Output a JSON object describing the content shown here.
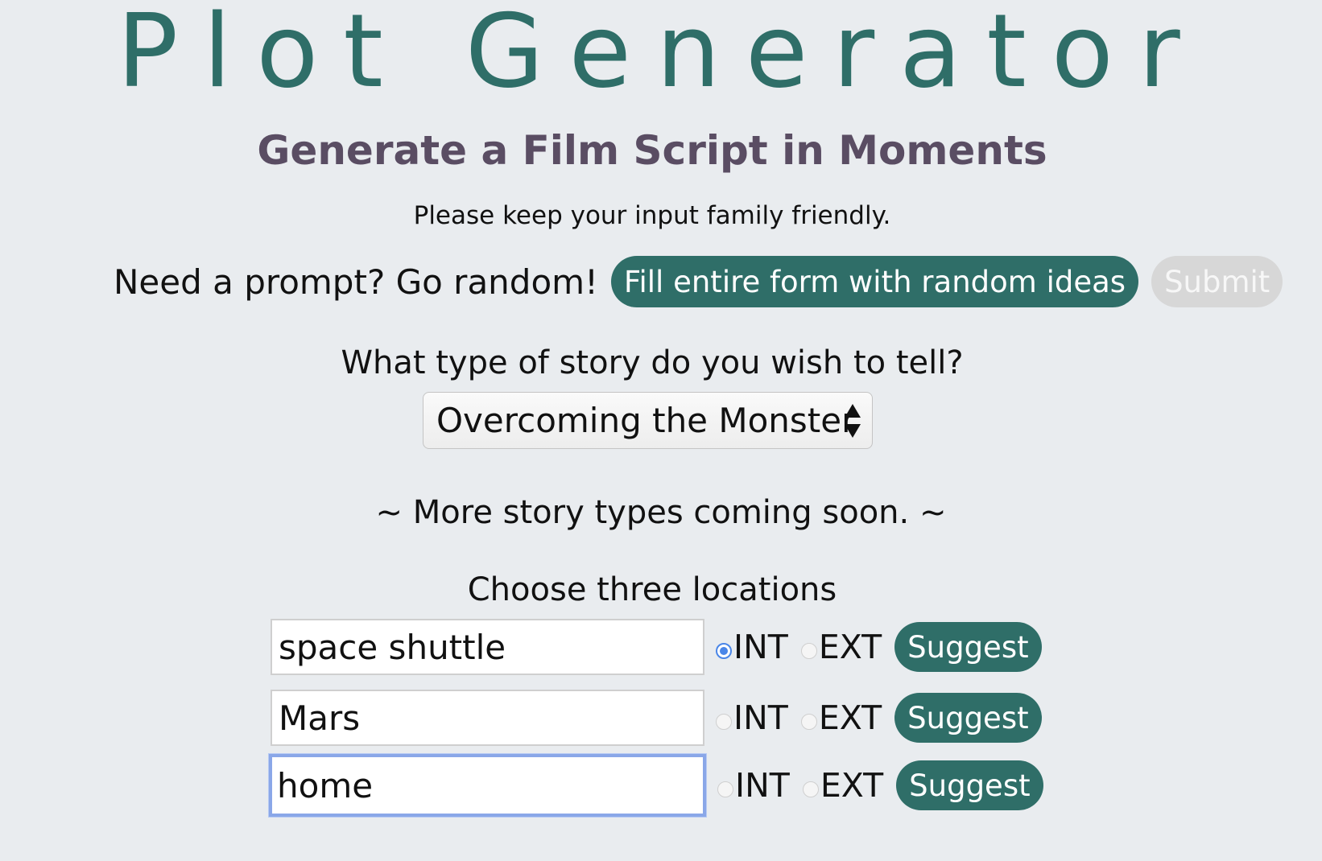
{
  "header": {
    "title": "Plot Generator",
    "subtitle": "Generate a Film Script in Moments",
    "note": "Please keep your input family friendly."
  },
  "random": {
    "label": "Need a prompt? Go random!",
    "fill_button": "Fill entire form with random ideas",
    "submit_button": "Submit"
  },
  "story": {
    "question": "What type of story do you wish to tell?",
    "selected": "Overcoming the Monster",
    "coming_soon": "~ More story types coming soon. ~"
  },
  "locations": {
    "label": "Choose three locations",
    "int_label": "INT",
    "ext_label": "EXT",
    "suggest_label": "Suggest",
    "rows": [
      {
        "value": "space shuttle",
        "selected": "INT"
      },
      {
        "value": "Mars",
        "selected": ""
      },
      {
        "value": "home",
        "selected": "",
        "focused": true
      }
    ]
  },
  "colors": {
    "accent": "#2f6e68",
    "subtitle": "#5a4d63",
    "background": "#e9ecef",
    "radio_checked": "#4a86e8"
  }
}
